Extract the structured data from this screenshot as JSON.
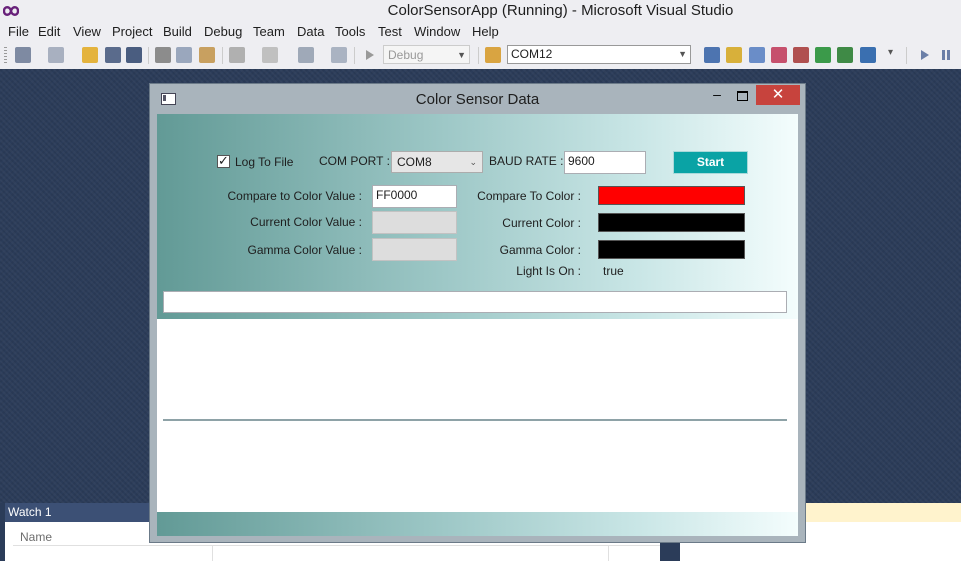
{
  "vs": {
    "title": "ColorSensorApp (Running) - Microsoft Visual Studio",
    "menu": [
      "File",
      "Edit",
      "View",
      "Project",
      "Build",
      "Debug",
      "Team",
      "Data",
      "Tools",
      "Test",
      "Window",
      "Help"
    ],
    "toolbar": {
      "config": "Debug",
      "com_port": "COM12",
      "icons": [
        "new-project-icon",
        "add-item-icon",
        "open-file-icon",
        "save-icon",
        "save-all-icon",
        "cut-icon",
        "copy-icon",
        "paste-icon",
        "undo-icon",
        "redo-icon",
        "navigate-back-icon",
        "navigate-forward-icon",
        "start-icon",
        "find-in-files-icon",
        "solution-explorer-icon",
        "properties-icon",
        "toolbox-icon",
        "team-explorer-icon",
        "tools-icon",
        "import-icon",
        "class-view-icon",
        "command-window-icon",
        "toolbar-overflow-icon",
        "continue-icon",
        "pause-icon"
      ]
    },
    "watch": {
      "title": "Watch 1",
      "name_col": "Name"
    }
  },
  "app": {
    "title": "Color Sensor Data",
    "close_glyph": "✕",
    "min_glyph": "–",
    "log_to_file": {
      "label": "Log To File",
      "checked": true
    },
    "com_port": {
      "label": "COM PORT :",
      "value": "COM8"
    },
    "baud_rate": {
      "label": "BAUD RATE :",
      "value": "9600"
    },
    "start_label": "Start",
    "compare_value": {
      "label": "Compare to Color Value :",
      "value": "FF0000"
    },
    "current_value": {
      "label": "Current Color Value :",
      "value": ""
    },
    "gamma_value": {
      "label": "Gamma Color Value :",
      "value": ""
    },
    "compare_color": {
      "label": "Compare To Color :",
      "color": "#ff0000"
    },
    "current_color": {
      "label": "Current Color :",
      "color": "#000000"
    },
    "gamma_color": {
      "label": "Gamma Color :",
      "color": "#000000"
    },
    "light_on": {
      "label": "Light Is On :",
      "value": "true"
    }
  }
}
